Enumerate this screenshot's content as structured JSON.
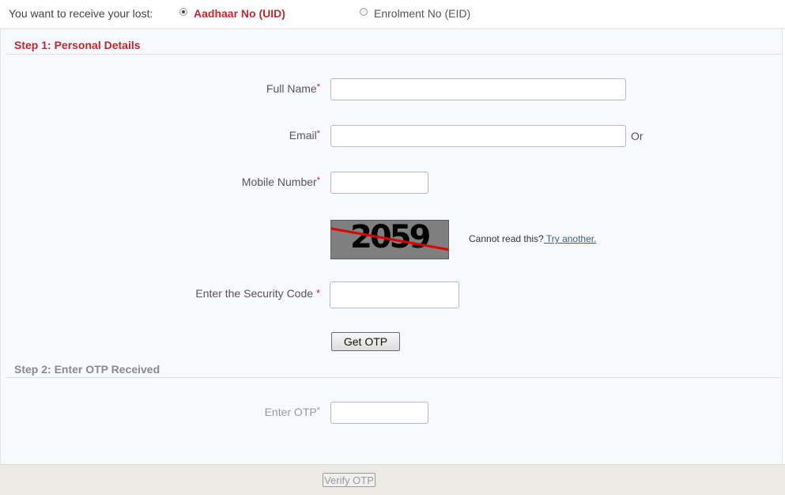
{
  "receive": {
    "prompt": "You want to receive your lost:",
    "options": [
      {
        "label": "Aadhaar No (UID)",
        "selected": true
      },
      {
        "label": "Enrolment No (EID)",
        "selected": false
      }
    ]
  },
  "step1": {
    "title": "Step 1: Personal Details",
    "full_name_label": "Full Name",
    "email_label": "Email",
    "or_text": "Or",
    "mobile_label": "Mobile Number",
    "required_mark": "*",
    "captcha_code": "2059",
    "captcha_help": "Cannot read this?",
    "captcha_try": " Try another.",
    "security_label": "Enter the Security Code",
    "get_otp_label": "Get OTP"
  },
  "step2": {
    "title": "Step 2: Enter OTP Received",
    "otp_label": "Enter OTP",
    "verify_label": "Verify OTP"
  },
  "colors": {
    "accent": "#c0272d",
    "panel_bg": "#f7f9fc",
    "footer_bg": "#ebeae3",
    "link": "#3a5f8a"
  }
}
